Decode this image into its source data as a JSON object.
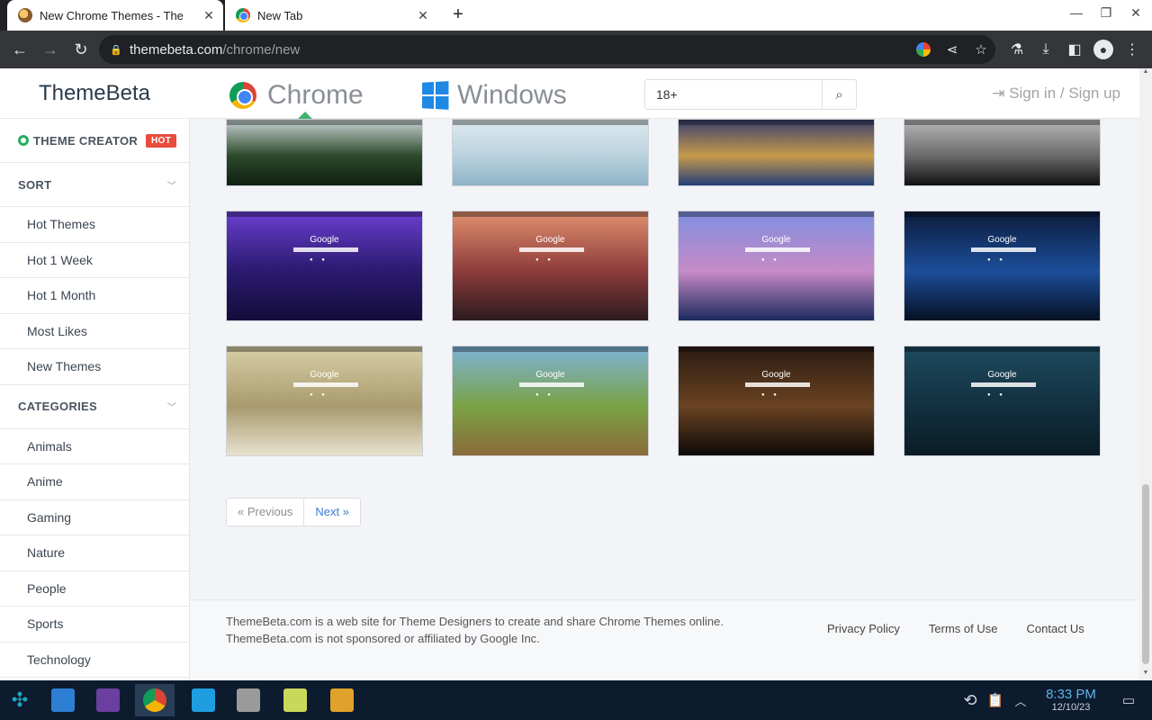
{
  "browser": {
    "tabs": [
      {
        "title": "New Chrome Themes - The",
        "active": true
      },
      {
        "title": "New Tab",
        "active": false
      }
    ],
    "url_host": "themebeta.com",
    "url_path": "/chrome/new"
  },
  "site": {
    "logo": "ThemeBeta",
    "nav": [
      {
        "label": "Chrome"
      },
      {
        "label": "Windows"
      }
    ],
    "search_value": "18+",
    "signin": "Sign in / Sign up"
  },
  "sidebar": {
    "creator": {
      "label": "THEME CREATOR",
      "badge": "HOT"
    },
    "sort": {
      "label": "SORT",
      "items": [
        "Hot Themes",
        "Hot 1 Week",
        "Hot 1 Month",
        "Most Likes",
        "New Themes"
      ]
    },
    "categories": {
      "label": "CATEGORIES",
      "items": [
        "Animals",
        "Anime",
        "Gaming",
        "Nature",
        "People",
        "Sports",
        "Technology"
      ]
    }
  },
  "thumbnails": [
    {
      "name": "forest-watchtower",
      "google": "",
      "colors": [
        "#c9d3d6",
        "#2c4a2a",
        "#0f1f12"
      ]
    },
    {
      "name": "anime-floral",
      "google": "",
      "colors": [
        "#dfe9ef",
        "#b9d2de",
        "#8eb3c7"
      ]
    },
    {
      "name": "anime-fireworks",
      "google": "",
      "colors": [
        "#3a3e6e",
        "#c89b4b",
        "#233f7a"
      ]
    },
    {
      "name": "monochrome-abstract",
      "google": "",
      "colors": [
        "#b8b8b8",
        "#6a6a6a",
        "#111111"
      ]
    },
    {
      "name": "purple-city",
      "google": "Google",
      "colors": [
        "#6a3fd0",
        "#2a1a6e",
        "#140c3a"
      ]
    },
    {
      "name": "sunset-girl-city",
      "google": "Google",
      "colors": [
        "#e0906e",
        "#8e3b3b",
        "#2b1b1f"
      ]
    },
    {
      "name": "pastel-sky-city",
      "google": "Google",
      "colors": [
        "#7e8fe0",
        "#c78ac6",
        "#1b2a5e"
      ]
    },
    {
      "name": "night-blue-city",
      "google": "Google",
      "colors": [
        "#0c1b3a",
        "#1c4e9a",
        "#061022"
      ]
    },
    {
      "name": "winter-street",
      "google": "Google",
      "colors": [
        "#d8cfa6",
        "#a89a6d",
        "#e8e2cf"
      ]
    },
    {
      "name": "green-valley",
      "google": "Google",
      "colors": [
        "#7db3d9",
        "#7aa244",
        "#8a6a3b"
      ]
    },
    {
      "name": "lantern-alley",
      "google": "Google",
      "colors": [
        "#2a1b12",
        "#6a4322",
        "#0e0a08"
      ]
    },
    {
      "name": "rainy-night-boy",
      "google": "Google",
      "colors": [
        "#1e4a5e",
        "#123040",
        "#0a1c26"
      ]
    }
  ],
  "pager": {
    "prev": "« Previous",
    "next": "Next »"
  },
  "footer": {
    "line1": "ThemeBeta.com is a web site for Theme Designers to create and share Chrome Themes online.",
    "line2": "ThemeBeta.com is not sponsored or affiliated by Google Inc.",
    "links": [
      "Privacy Policy",
      "Terms of Use",
      "Contact Us"
    ]
  },
  "taskbar": {
    "time": "8:33 PM",
    "date": "12/10/23",
    "apps": [
      {
        "name": "app-launcher",
        "color": "#1ea7c5"
      },
      {
        "name": "store",
        "color": "#2d7fd3"
      },
      {
        "name": "file-manager",
        "color": "#6b3fa0"
      },
      {
        "name": "chrome",
        "color": "#db4437"
      },
      {
        "name": "transfer",
        "color": "#1e9ee0"
      },
      {
        "name": "archive",
        "color": "#9a9a9a"
      },
      {
        "name": "wine",
        "color": "#c8d85a"
      },
      {
        "name": "windows",
        "color": "#e0a22a"
      }
    ]
  },
  "colors": {
    "accent": "#3a7bd5",
    "hot": "#e74c3c",
    "creator": "#27ae60"
  }
}
